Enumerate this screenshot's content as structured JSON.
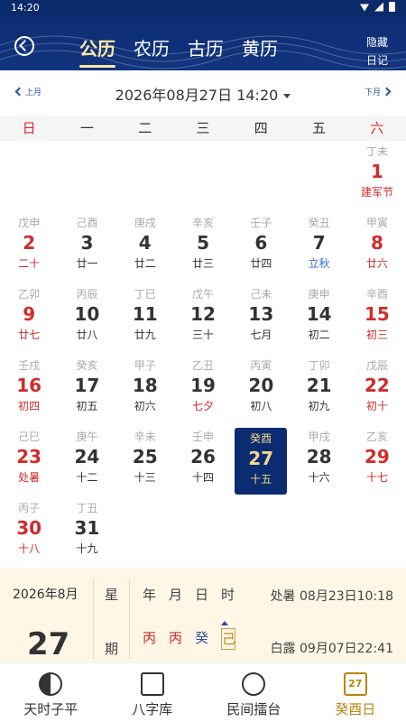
{
  "status": {
    "time": "14:20"
  },
  "header": {
    "tabs": [
      "公历",
      "农历",
      "古历",
      "黄历"
    ],
    "active_tab": "公历",
    "hide_diary": "隐藏日记"
  },
  "nav": {
    "prev": "上月",
    "next": "下月",
    "current": "2026年08月27日 14:20"
  },
  "weekdays": [
    "日",
    "一",
    "二",
    "三",
    "四",
    "五",
    "六"
  ],
  "days": [
    {
      "gz": "丁未",
      "d": "1",
      "l": "建军节",
      "lc": "red"
    },
    {
      "gz": "戊申",
      "d": "2",
      "l": "二十",
      "lc": "red"
    },
    {
      "gz": "己酉",
      "d": "3",
      "l": "廿一",
      "lc": ""
    },
    {
      "gz": "庚戌",
      "d": "4",
      "l": "廿二",
      "lc": ""
    },
    {
      "gz": "辛亥",
      "d": "5",
      "l": "廿三",
      "lc": ""
    },
    {
      "gz": "壬子",
      "d": "6",
      "l": "廿四",
      "lc": ""
    },
    {
      "gz": "癸丑",
      "d": "7",
      "l": "立秋",
      "lc": "blue"
    },
    {
      "gz": "甲寅",
      "d": "8",
      "l": "廿六",
      "lc": "red"
    },
    {
      "gz": "乙卯",
      "d": "9",
      "l": "廿七",
      "lc": "red"
    },
    {
      "gz": "丙辰",
      "d": "10",
      "l": "廿八",
      "lc": ""
    },
    {
      "gz": "丁巳",
      "d": "11",
      "l": "廿九",
      "lc": ""
    },
    {
      "gz": "戊午",
      "d": "12",
      "l": "三十",
      "lc": ""
    },
    {
      "gz": "己未",
      "d": "13",
      "l": "七月",
      "lc": ""
    },
    {
      "gz": "庚申",
      "d": "14",
      "l": "初二",
      "lc": ""
    },
    {
      "gz": "辛酉",
      "d": "15",
      "l": "初三",
      "lc": "red"
    },
    {
      "gz": "壬戌",
      "d": "16",
      "l": "初四",
      "lc": "red"
    },
    {
      "gz": "癸亥",
      "d": "17",
      "l": "初五",
      "lc": ""
    },
    {
      "gz": "甲子",
      "d": "18",
      "l": "初六",
      "lc": ""
    },
    {
      "gz": "乙丑",
      "d": "19",
      "l": "七夕",
      "lc": "red"
    },
    {
      "gz": "丙寅",
      "d": "20",
      "l": "初八",
      "lc": ""
    },
    {
      "gz": "丁卯",
      "d": "21",
      "l": "初九",
      "lc": ""
    },
    {
      "gz": "戊辰",
      "d": "22",
      "l": "初十",
      "lc": "red"
    },
    {
      "gz": "己巳",
      "d": "23",
      "l": "处暑",
      "lc": "red"
    },
    {
      "gz": "庚午",
      "d": "24",
      "l": "十二",
      "lc": ""
    },
    {
      "gz": "辛未",
      "d": "25",
      "l": "十三",
      "lc": ""
    },
    {
      "gz": "壬申",
      "d": "26",
      "l": "十四",
      "lc": ""
    },
    {
      "gz": "癸酉",
      "d": "27",
      "l": "十五",
      "lc": ""
    },
    {
      "gz": "甲戌",
      "d": "28",
      "l": "十六",
      "lc": ""
    },
    {
      "gz": "乙亥",
      "d": "29",
      "l": "十七",
      "lc": "red"
    },
    {
      "gz": "丙子",
      "d": "30",
      "l": "十八",
      "lc": "red"
    },
    {
      "gz": "丁丑",
      "d": "31",
      "l": "十九",
      "lc": ""
    }
  ],
  "selected_day": "27",
  "info": {
    "year_month": "2026年8月",
    "day": "27",
    "xing": "星",
    "qi": "期",
    "pillar_headers": [
      "年",
      "月",
      "日",
      "时"
    ],
    "pillars": [
      "丙",
      "丙",
      "癸",
      "己"
    ],
    "term1": "处暑 08月23日10:18",
    "term2": "白露 09月07日22:41"
  },
  "bottom_nav": [
    {
      "label": "天时子平",
      "icon": "yin-yang-icon"
    },
    {
      "label": "八字库",
      "icon": "books-icon"
    },
    {
      "label": "民间擂台",
      "icon": "stage-icon"
    },
    {
      "label": "癸酉日",
      "icon": "calendar-icon",
      "icon_text": "27",
      "active": true
    }
  ]
}
